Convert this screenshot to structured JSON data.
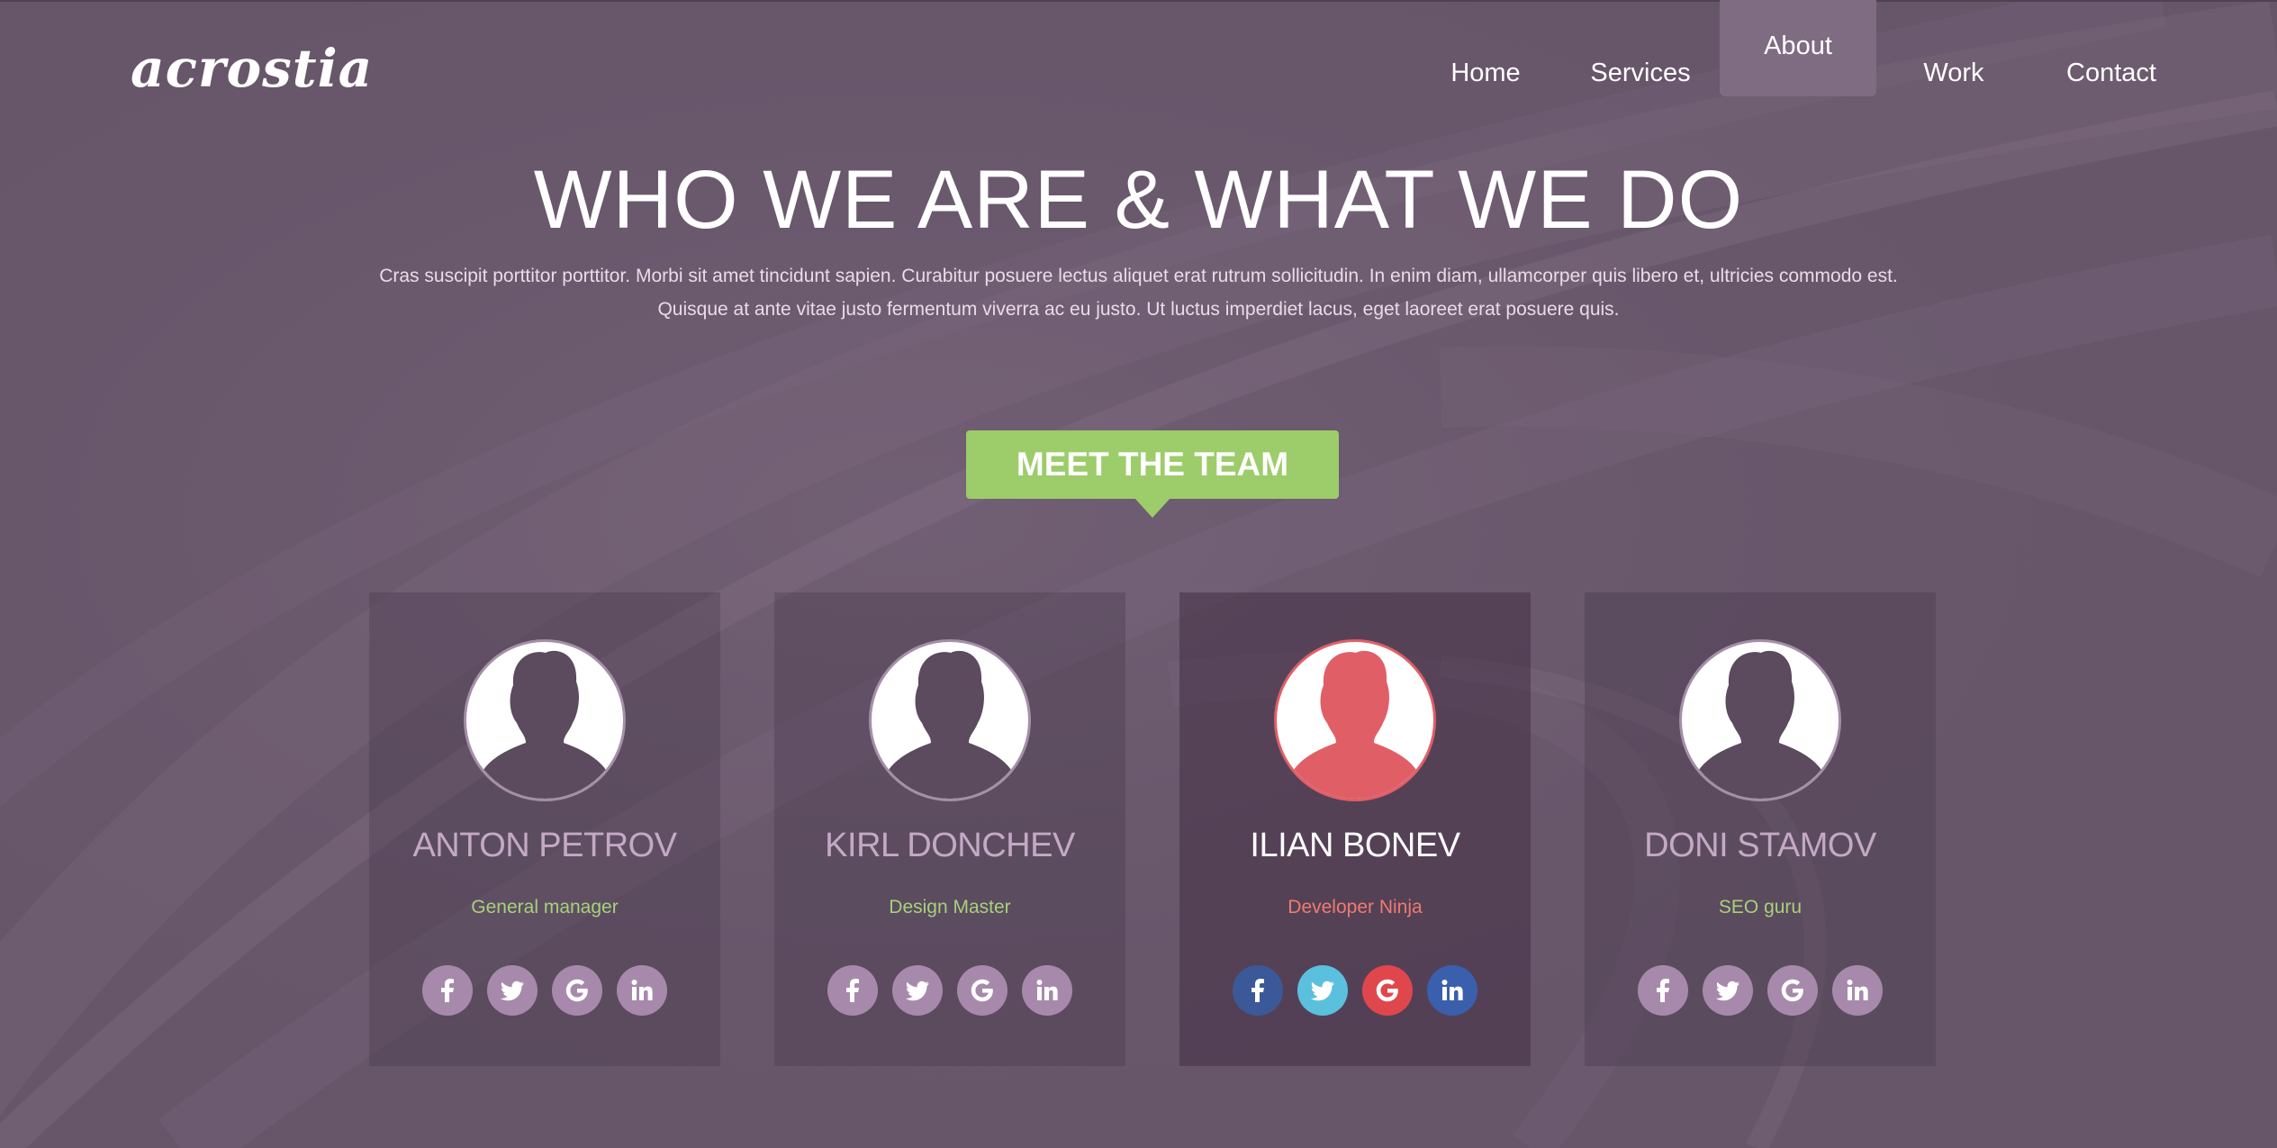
{
  "logo": "acrostia",
  "nav": {
    "items": [
      {
        "label": "Home"
      },
      {
        "label": "Services"
      },
      {
        "label": "About"
      },
      {
        "label": "Work"
      },
      {
        "label": "Contact"
      }
    ],
    "active": "About"
  },
  "hero": {
    "title": "WHO WE ARE & WHAT WE DO",
    "text_line1": "Cras suscipit porttitor porttitor. Morbi sit amet tincidunt sapien. Curabitur posuere lectus aliquet erat rutrum sollicitudin. In enim diam, ullamcorper quis libero et, ultricies commodo est.",
    "text_line2": "Quisque at ante vitae justo fermentum viverra ac eu justo. Ut luctus imperdiet lacus, eget laoreet erat posuere quis."
  },
  "team_button": "MEET THE TEAM",
  "team": [
    {
      "name": "ANTON PETROV",
      "role": "General manager",
      "role_color": "#a6d17a"
    },
    {
      "name": "KIRL DONCHEV",
      "role": "Design Master",
      "role_color": "#a6d17a"
    },
    {
      "name": "ILIAN BONEV",
      "role": "Developer Ninja",
      "role_color": "#ef7b6f",
      "highlighted": true
    },
    {
      "name": "DONI STAMOV",
      "role": "SEO guru",
      "role_color": "#a6d17a"
    }
  ],
  "social_icons": [
    "facebook-icon",
    "twitter-icon",
    "google-icon",
    "linkedin-icon"
  ],
  "colors": {
    "background": "#67566a",
    "accent_green": "#9dcc6a",
    "highlight_red": "#e05f67",
    "facebook": "#3b5998",
    "twitter": "#5bc0de",
    "google": "#e0474c",
    "linkedin": "#3a5fad",
    "social_default": "#a78aab"
  }
}
